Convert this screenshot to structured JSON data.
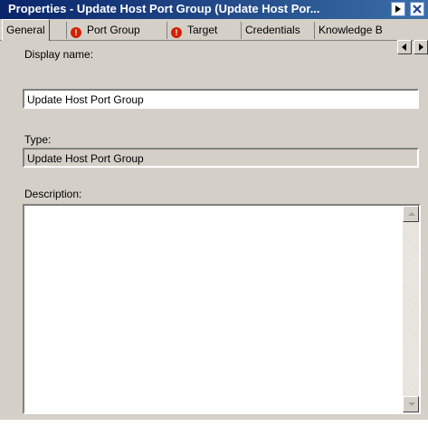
{
  "window": {
    "title": "Properties - Update Host Port Group (Update Host Por..."
  },
  "tabs": [
    {
      "label": "General",
      "warning": false
    },
    {
      "label": "Port Group",
      "warning": true
    },
    {
      "label": "Target",
      "warning": true
    },
    {
      "label": "Credentials",
      "warning": false
    },
    {
      "label": "Knowledge B",
      "warning": false
    }
  ],
  "warning_glyph": "!",
  "form": {
    "display_name_label": "Display name:",
    "display_name_value": "Update Host Port Group",
    "type_label": "Type:",
    "type_value": "Update Host Port Group",
    "description_label": "Description:",
    "description_value": ""
  },
  "colors": {
    "title_start": "#0a246a",
    "title_end": "#3a6ea5",
    "warning": "#d02200",
    "face": "#d4d0c8"
  }
}
